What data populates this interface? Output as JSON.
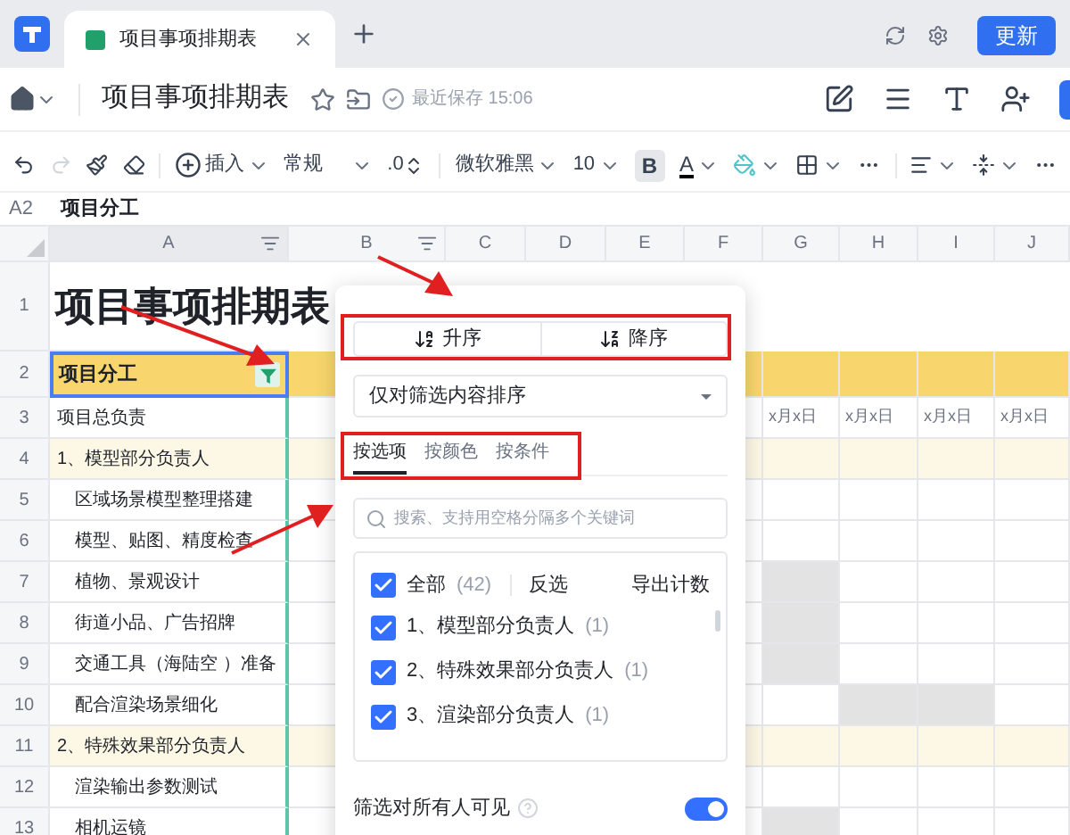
{
  "app_tab": {
    "title": "项目事项排期表"
  },
  "update_button": "更新",
  "doc": {
    "title": "项目事项排期表",
    "save_status": "最近保存 15:06"
  },
  "toolbar": {
    "insert": "插入",
    "number_format": "常规",
    "decimal": ".0",
    "font": "微软雅黑",
    "font_size": "10",
    "bold": {
      "label": "B",
      "on": true
    },
    "font_color": "A"
  },
  "formula_bar": {
    "cell_ref": "A2",
    "value": "项目分工"
  },
  "columns": [
    "A",
    "B",
    "C",
    "D",
    "E",
    "F",
    "G",
    "H",
    "I",
    "J"
  ],
  "rows": [
    {
      "number": "1",
      "kind": "title",
      "text": "项目事项排期表"
    },
    {
      "number": "2",
      "kind": "header",
      "text": "项目分工"
    },
    {
      "number": "3",
      "kind": "plain",
      "text": "项目总负责",
      "gantt": [
        {
          "text": "x月x日",
          "shaded": false
        },
        {
          "text": "x月x日",
          "shaded": false
        },
        {
          "text": "x月x日",
          "shaded": false
        },
        {
          "text": "x月x日",
          "shaded": false
        }
      ]
    },
    {
      "number": "4",
      "kind": "group",
      "text": "1、模型部分负责人"
    },
    {
      "number": "5",
      "kind": "item",
      "text": "区域场景模型整理搭建"
    },
    {
      "number": "6",
      "kind": "item",
      "text": "模型、贴图、精度检查"
    },
    {
      "number": "7",
      "kind": "item",
      "text": "植物、景观设计",
      "gantt": [
        {
          "shaded": true
        },
        {
          "shaded": false
        },
        {
          "shaded": false
        },
        {
          "shaded": false
        }
      ]
    },
    {
      "number": "8",
      "kind": "item",
      "text": "街道小品、广告招牌",
      "gantt": [
        {
          "shaded": true
        },
        {
          "shaded": false
        },
        {
          "shaded": false
        },
        {
          "shaded": false
        }
      ]
    },
    {
      "number": "9",
      "kind": "item",
      "text": "交通工具（海陆空 ）准备",
      "gantt": [
        {
          "shaded": true
        },
        {
          "shaded": false
        },
        {
          "shaded": false
        },
        {
          "shaded": false
        }
      ]
    },
    {
      "number": "10",
      "kind": "item",
      "text": "配合渲染场景细化",
      "gantt": [
        {
          "shaded": false
        },
        {
          "shaded": true
        },
        {
          "shaded": true
        },
        {
          "shaded": false
        }
      ]
    },
    {
      "number": "11",
      "kind": "group",
      "text": "2、特殊效果部分负责人"
    },
    {
      "number": "12",
      "kind": "item",
      "text": "渲染输出参数测试"
    },
    {
      "number": "13",
      "kind": "item",
      "text": "相机运镜",
      "gantt": [
        {
          "shaded": true
        },
        {
          "shaded": false
        },
        {
          "shaded": false
        },
        {
          "shaded": false
        }
      ]
    }
  ],
  "filter_popup": {
    "sort_buttons": [
      "升序",
      "降序"
    ],
    "sort_scope": "仅对筛选内容排序",
    "tabs": [
      {
        "label": "按选项",
        "selected": true
      },
      {
        "label": "按颜色",
        "selected": false
      },
      {
        "label": "按条件",
        "selected": false
      }
    ],
    "search": {
      "placeholder": "搜索、支持用空格分隔多个关键词"
    },
    "select_all": {
      "label": "全部",
      "count": "(42)",
      "checked": true
    },
    "invert": "反选",
    "export": "导出计数",
    "options": [
      {
        "label": "1、模型部分负责人",
        "count": "(1)",
        "checked": true
      },
      {
        "label": "2、特殊效果部分负责人",
        "count": "(1)",
        "checked": true
      },
      {
        "label": "3、渲染部分负责人",
        "count": "(1)",
        "checked": true
      }
    ],
    "visibility": {
      "label": "筛选对所有人可见",
      "on": true
    }
  }
}
